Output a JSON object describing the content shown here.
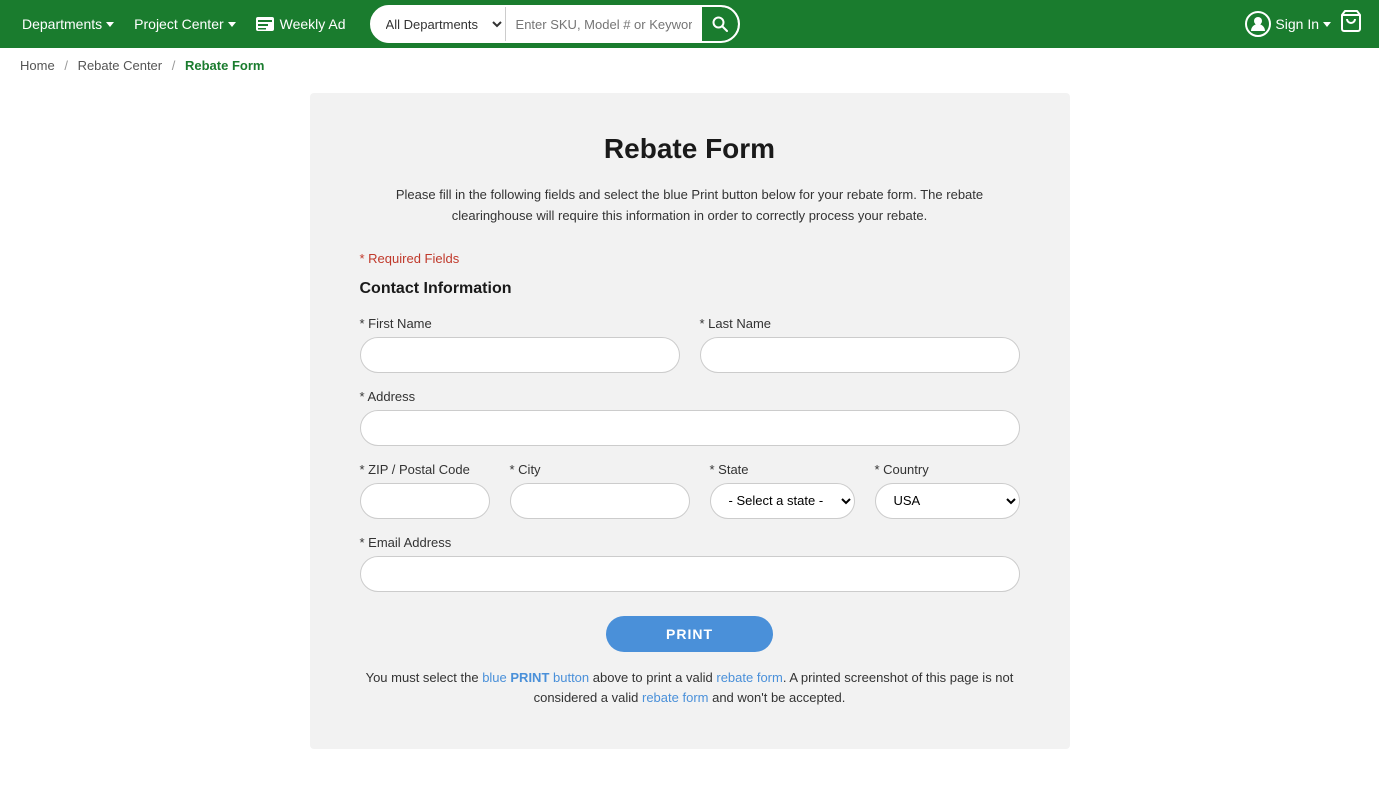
{
  "header": {
    "departments_label": "Departments",
    "project_center_label": "Project Center",
    "weekly_ad_label": "Weekly Ad",
    "search_placeholder": "Enter SKU, Model # or Keyword",
    "all_departments_label": "All Departments",
    "sign_in_label": "Sign In"
  },
  "breadcrumb": {
    "home": "Home",
    "rebate_center": "Rebate Center",
    "current": "Rebate Form"
  },
  "form": {
    "title": "Rebate Form",
    "description_part1": "Please fill in the following fields and select the blue Print button below for your rebate form. The rebate clearinghouse will require this information in order to correctly process your rebate.",
    "required_note": "* Required Fields",
    "section_title": "Contact Information",
    "first_name_label": "* First Name",
    "last_name_label": "* Last Name",
    "address_label": "* Address",
    "zip_label": "* ZIP / Postal Code",
    "city_label": "* City",
    "state_label": "* State",
    "country_label": "* Country",
    "email_label": "* Email Address",
    "state_default": "- Select a state -",
    "country_default": "USA",
    "print_button": "PRINT",
    "print_note": "You must select the blue PRINT button above to print a valid rebate form. A printed screenshot of this page is not considered a valid rebate form and won't be accepted."
  }
}
